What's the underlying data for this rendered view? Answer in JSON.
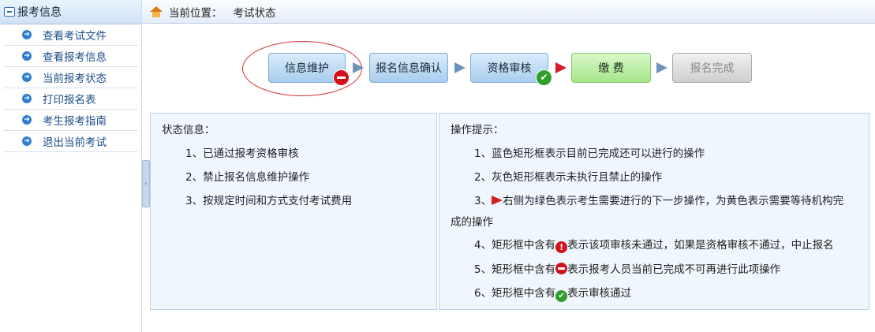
{
  "sidebar": {
    "header": "报考信息",
    "items": [
      {
        "label": "查看考试文件"
      },
      {
        "label": "查看报考信息"
      },
      {
        "label": "当前报考状态"
      },
      {
        "label": "打印报名表"
      },
      {
        "label": "考生报考指南"
      },
      {
        "label": "退出当前考试"
      }
    ]
  },
  "breadcrumb": {
    "label": "当前位置：",
    "current": "考试状态"
  },
  "steps": [
    {
      "label": "信息维护",
      "style": "blue",
      "badge": "minus"
    },
    {
      "label": "报名信息确认",
      "style": "blue"
    },
    {
      "label": "资格审核",
      "style": "blue",
      "badge": "check"
    },
    {
      "label": "缴 费",
      "style": "green"
    },
    {
      "label": "报名完成",
      "style": "gray"
    }
  ],
  "status_panel": {
    "title": "状态信息：",
    "lines": [
      "1、已通过报考资格审核",
      "2、禁止报名信息维护操作",
      "3、按规定时间和方式支付考试费用"
    ]
  },
  "tips_panel": {
    "title": "操作提示：",
    "line1": "1、蓝色矩形框表示目前已完成还可以进行的操作",
    "line2": "2、灰色矩形框表示未执行且禁止的操作",
    "line3_prefix": "3、",
    "line3_rest": "右侧为绿色表示考生需要进行的下一步操作，为黄色表示需要等待机构完",
    "line3_cont": "成的操作",
    "line4_prefix": "4、矩形框中含有",
    "line4_rest": "表示该项审核未通过，如果是资格审核不通过，中止报名",
    "line5_prefix": "5、矩形框中含有",
    "line5_rest": "表示报考人员当前已完成不可再进行此项操作",
    "line6_prefix": "6、矩形框中含有",
    "line6_rest": "表示审核通过"
  },
  "colors": {
    "step_blue": "#a8cdee",
    "step_green": "#a5e68a",
    "step_gray": "#cfcfcf",
    "badge_red": "#d3111b",
    "badge_green": "#2f9e2a",
    "arrow_red": "#d51c24"
  }
}
